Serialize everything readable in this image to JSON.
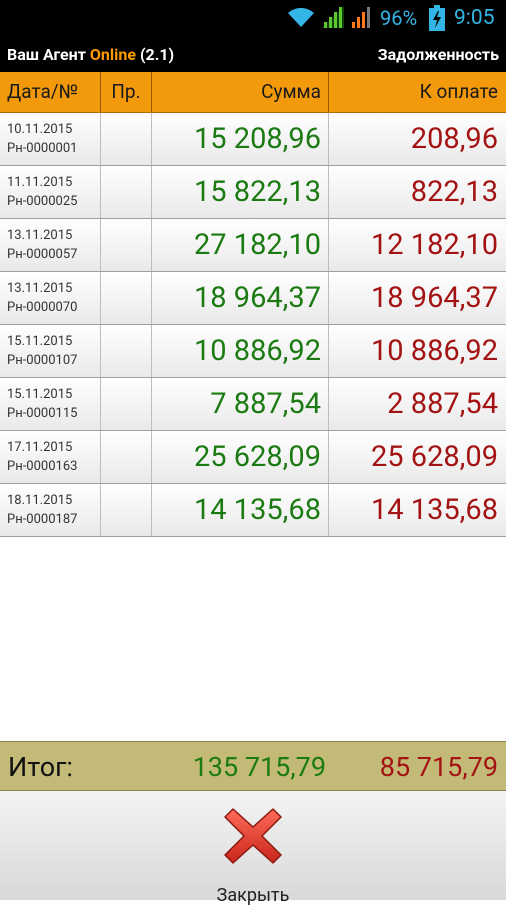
{
  "status_bar": {
    "battery_percent": "96%",
    "time": "9:05",
    "icons": [
      "wifi-icon",
      "signal-icon",
      "signal-icon",
      "battery-charging-icon"
    ]
  },
  "header": {
    "app_name": "Ваш Агент",
    "app_accent": "Online",
    "app_version": "(2.1)",
    "screen_title": "Задолженность"
  },
  "table": {
    "columns": [
      "Дата/№",
      "Пр.",
      "Сумма",
      "К оплате"
    ],
    "rows": [
      {
        "date": "10.11.2015",
        "number": "Рн-0000001",
        "pr": "",
        "sum": "15 208,96",
        "to_pay": "208,96"
      },
      {
        "date": "11.11.2015",
        "number": "Рн-0000025",
        "pr": "",
        "sum": "15 822,13",
        "to_pay": "822,13"
      },
      {
        "date": "13.11.2015",
        "number": "Рн-0000057",
        "pr": "",
        "sum": "27 182,10",
        "to_pay": "12 182,10"
      },
      {
        "date": "13.11.2015",
        "number": "Рн-0000070",
        "pr": "",
        "sum": "18 964,37",
        "to_pay": "18 964,37"
      },
      {
        "date": "15.11.2015",
        "number": "Рн-0000107",
        "pr": "",
        "sum": "10 886,92",
        "to_pay": "10 886,92"
      },
      {
        "date": "15.11.2015",
        "number": "Рн-0000115",
        "pr": "",
        "sum": "7 887,54",
        "to_pay": "2 887,54"
      },
      {
        "date": "17.11.2015",
        "number": "Рн-0000163",
        "pr": "",
        "sum": "25 628,09",
        "to_pay": "25 628,09"
      },
      {
        "date": "18.11.2015",
        "number": "Рн-0000187",
        "pr": "",
        "sum": "14 135,68",
        "to_pay": "14 135,68"
      }
    ]
  },
  "totals": {
    "label": "Итог:",
    "sum": "135 715,79",
    "to_pay": "85 715,79"
  },
  "footer": {
    "close_label": "Закрыть"
  },
  "colors": {
    "header_orange": "#f39a0c",
    "sum_green": "#1b7a12",
    "to_pay_red": "#a31313",
    "totals_bg": "#c4ba78",
    "status_blue": "#33b5e5"
  }
}
